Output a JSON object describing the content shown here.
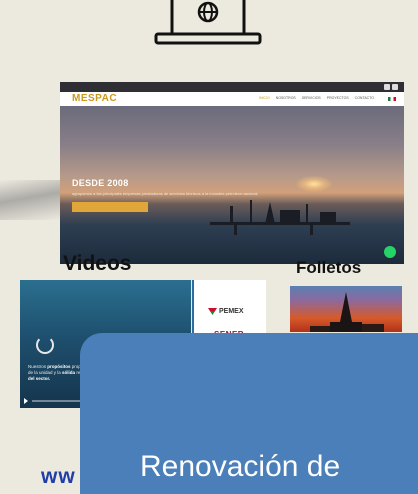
{
  "website": {
    "top_strip_text": "",
    "logo_text": "MESPAC",
    "menu_items": [
      "INICIO",
      "NOSOTROS",
      "SERVICIOS",
      "PROYECTOS",
      "CONTACTO"
    ],
    "hero_title": "DESDE 2008",
    "hero_tagline": "agrupamos a las principales empresas prestadoras de servicios técnicos a la industria petrolera nacional",
    "hero_button": ""
  },
  "sections": {
    "videos_heading": "Videos",
    "folletos_heading": "Folletos"
  },
  "video": {
    "caption_line1": "Nuestros ",
    "caption_bold1": "propósitos",
    "caption_line2": " propuestos de la unidad",
    "caption_line3": " y la ",
    "caption_bold2": "sólida",
    "caption_line4": " reputación",
    "caption_bold3": "del sector."
  },
  "logos": {
    "pemex": "PEMEX",
    "sener": "SENER"
  },
  "card": {
    "label": "Renovación de"
  },
  "footer": {
    "url_fragment": "ww"
  },
  "colors": {
    "background": "#ece9df",
    "card_blue": "#4a7fb9",
    "accent_gold": "#c79a22",
    "url_blue": "#1e3ea8"
  }
}
